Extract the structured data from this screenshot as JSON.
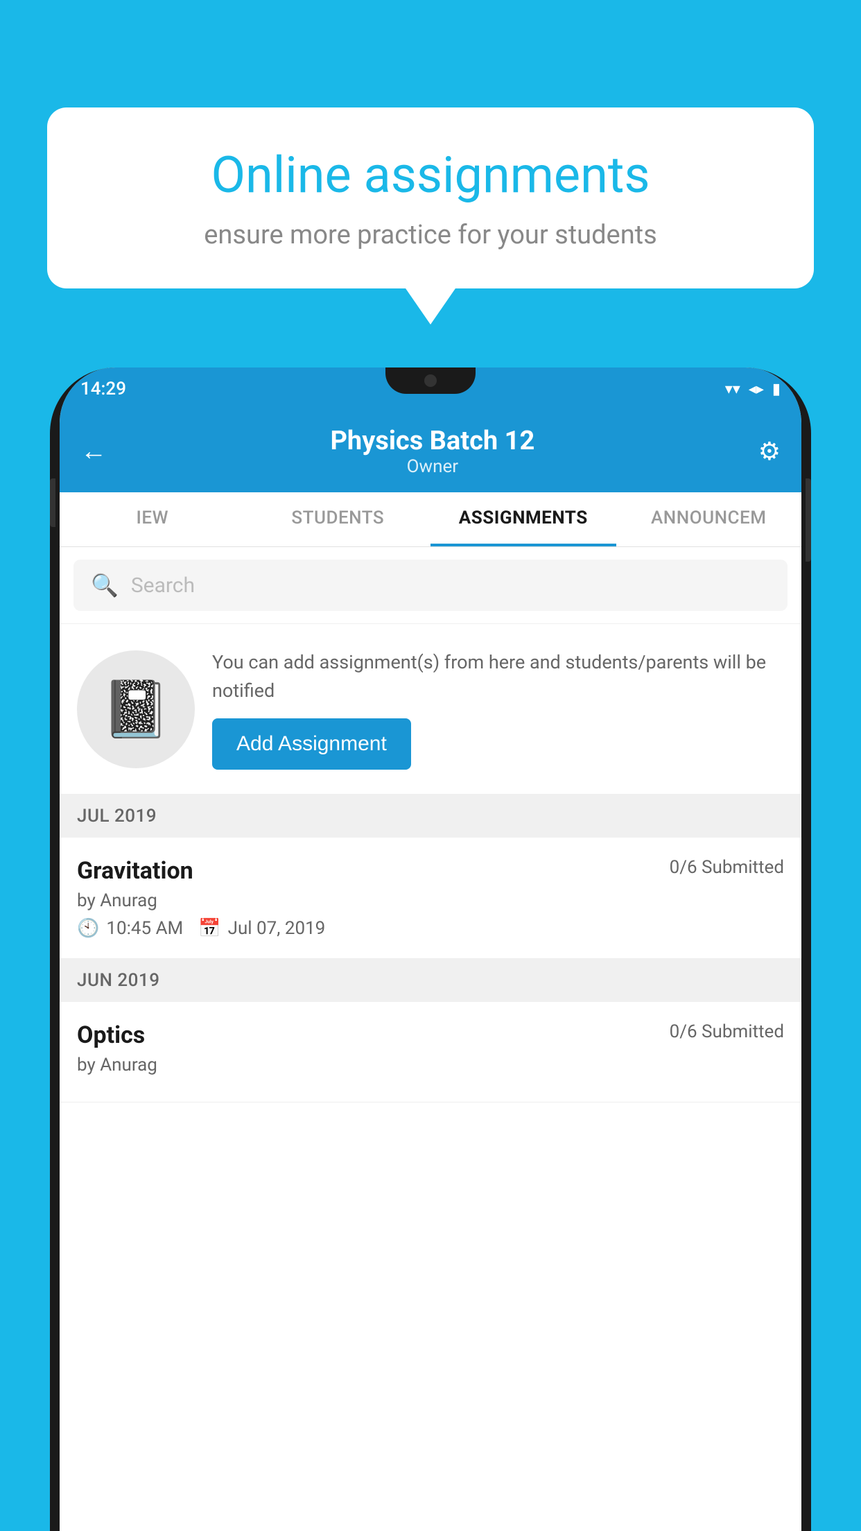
{
  "background_color": "#1ab8e8",
  "speech_bubble": {
    "title": "Online assignments",
    "subtitle": "ensure more practice for your students"
  },
  "status_bar": {
    "time": "14:29",
    "wifi_icon": "▾",
    "signal_icon": "◂",
    "battery_icon": "▮"
  },
  "header": {
    "title": "Physics Batch 12",
    "subtitle": "Owner",
    "back_icon": "←",
    "settings_icon": "⚙"
  },
  "tabs": [
    {
      "label": "IEW",
      "active": false
    },
    {
      "label": "STUDENTS",
      "active": false
    },
    {
      "label": "ASSIGNMENTS",
      "active": true
    },
    {
      "label": "ANNOUNCEM",
      "active": false
    }
  ],
  "search": {
    "placeholder": "Search"
  },
  "promo": {
    "description": "You can add assignment(s) from here and students/parents will be notified",
    "button_label": "Add Assignment"
  },
  "month_sections": [
    {
      "month_label": "JUL 2019",
      "assignments": [
        {
          "name": "Gravitation",
          "submitted": "0/6 Submitted",
          "by": "by Anurag",
          "time": "10:45 AM",
          "date": "Jul 07, 2019"
        }
      ]
    },
    {
      "month_label": "JUN 2019",
      "assignments": [
        {
          "name": "Optics",
          "submitted": "0/6 Submitted",
          "by": "by Anurag",
          "time": "",
          "date": ""
        }
      ]
    }
  ]
}
